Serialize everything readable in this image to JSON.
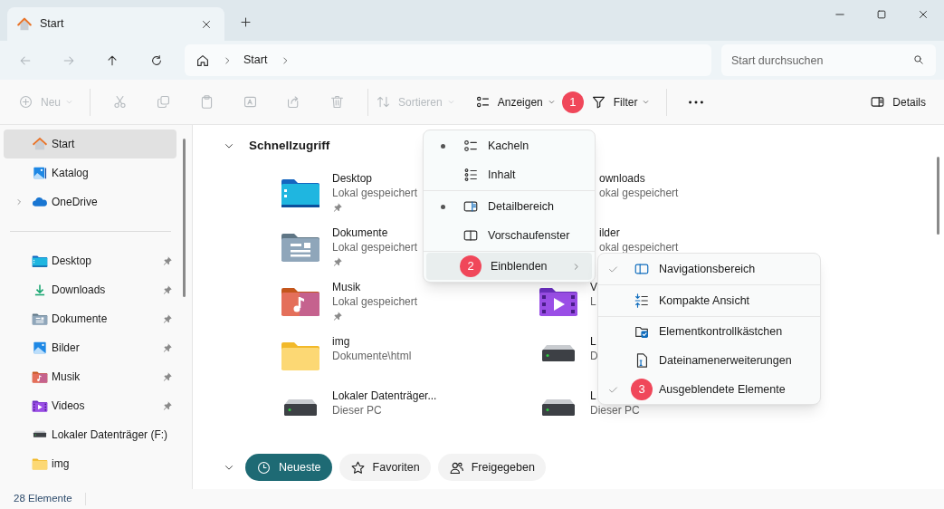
{
  "window": {
    "tab_title": "Start"
  },
  "navigation": {
    "path": [
      "Start"
    ],
    "search_placeholder": "Start durchsuchen"
  },
  "toolbar": {
    "items": [
      {
        "kind": "new",
        "label": "Neu",
        "disabled": true
      },
      {
        "kind": "cut",
        "disabled": true
      },
      {
        "kind": "copy",
        "disabled": true
      },
      {
        "kind": "paste",
        "disabled": true
      },
      {
        "kind": "rename",
        "disabled": true
      },
      {
        "kind": "share",
        "disabled": true
      },
      {
        "kind": "delete",
        "disabled": true
      },
      {
        "kind": "sort",
        "label": "Sortieren",
        "disabled": true
      },
      {
        "kind": "view",
        "label": "Anzeigen",
        "disabled": false,
        "badge": "1"
      },
      {
        "kind": "filter",
        "label": "Filter",
        "disabled": false
      },
      {
        "kind": "more",
        "disabled": false
      },
      {
        "kind": "details",
        "label": "Details",
        "disabled": false
      }
    ]
  },
  "sidebar": {
    "groups": [
      [
        {
          "label": "Start",
          "kind": "home",
          "selected": true,
          "pinned": false,
          "expandable": false
        },
        {
          "label": "Katalog",
          "kind": "catalog",
          "selected": false,
          "pinned": false,
          "expandable": false
        },
        {
          "label": "OneDrive",
          "kind": "onedrive",
          "selected": false,
          "pinned": false,
          "expandable": true
        }
      ],
      [
        {
          "label": "Desktop",
          "kind": "desktop",
          "selected": false,
          "pinned": true,
          "expandable": false
        },
        {
          "label": "Downloads",
          "kind": "downloads",
          "selected": false,
          "pinned": true,
          "expandable": false
        },
        {
          "label": "Dokumente",
          "kind": "documents",
          "selected": false,
          "pinned": true,
          "expandable": false
        },
        {
          "label": "Bilder",
          "kind": "pictures",
          "selected": false,
          "pinned": true,
          "expandable": false
        },
        {
          "label": "Musik",
          "kind": "music",
          "selected": false,
          "pinned": true,
          "expandable": false
        },
        {
          "label": "Videos",
          "kind": "videos",
          "selected": false,
          "pinned": true,
          "expandable": false
        },
        {
          "label": "Lokaler Datenträger (F:)",
          "kind": "drive",
          "selected": false,
          "pinned": false,
          "expandable": false
        },
        {
          "label": "img",
          "kind": "folder",
          "selected": false,
          "pinned": false,
          "expandable": false
        }
      ]
    ]
  },
  "quick_access": {
    "title": "Schnellzugriff",
    "items": [
      {
        "kind": "desktop",
        "name": "Desktop",
        "detail": "Lokal gespeichert",
        "pinned": true
      },
      {
        "kind": "covered",
        "name": "ownloads",
        "detail": "okal gespeichert",
        "pinned": false
      },
      {
        "kind": "documents",
        "name": "Dokumente",
        "detail": "Lokal gespeichert",
        "pinned": true
      },
      {
        "kind": "covered",
        "name": "ilder",
        "detail": "okal gespeichert",
        "pinned": false
      },
      {
        "kind": "music",
        "name": "Musik",
        "detail": "Lokal gespeichert",
        "pinned": true
      },
      {
        "kind": "videos",
        "name": "V",
        "detail": "L",
        "pinned": false
      },
      {
        "kind": "folder",
        "name": "img",
        "detail": "Dokumente\\html",
        "pinned": false
      },
      {
        "kind": "drive",
        "name": "L",
        "detail": "D",
        "pinned": false
      },
      {
        "kind": "drive",
        "name": "Lokaler Datenträger...",
        "detail": "Dieser PC",
        "pinned": false
      },
      {
        "kind": "drive",
        "name": "L",
        "detail": "Dieser PC",
        "pinned": false
      }
    ]
  },
  "chips": [
    {
      "label": "Neueste",
      "kind": "clock",
      "selected": true
    },
    {
      "label": "Favoriten",
      "kind": "star",
      "selected": false
    },
    {
      "label": "Freigegeben",
      "kind": "people",
      "selected": false
    }
  ],
  "view_menu": {
    "groups": [
      [
        {
          "kind": "tiles",
          "label": "Kacheln",
          "selected": true
        },
        {
          "kind": "content",
          "label": "Inhalt",
          "selected": false
        }
      ],
      [
        {
          "kind": "detail-pane",
          "label": "Detailbereich",
          "selected": true
        },
        {
          "kind": "preview-pane",
          "label": "Vorschaufenster",
          "selected": false
        }
      ],
      [
        {
          "kind": "submenu",
          "label": "Einblenden",
          "badge": "2",
          "expanded": true
        }
      ]
    ]
  },
  "show_submenu": {
    "groups": [
      [
        {
          "label": "Navigationsbereich",
          "kind": "nav-pane",
          "checked": true
        }
      ],
      [
        {
          "label": "Kompakte Ansicht",
          "kind": "compact",
          "checked": false
        }
      ],
      [
        {
          "label": "Elementkontrollkästchen",
          "kind": "checkbox-folder",
          "checked": false
        },
        {
          "label": "Dateinamenerweiterungen",
          "kind": "file-ext",
          "checked": false
        },
        {
          "label": "Ausgeblendete Elemente",
          "kind": "badge",
          "badge": "3",
          "checked": true
        }
      ]
    ]
  },
  "status_bar": {
    "count": "28 Elemente"
  }
}
